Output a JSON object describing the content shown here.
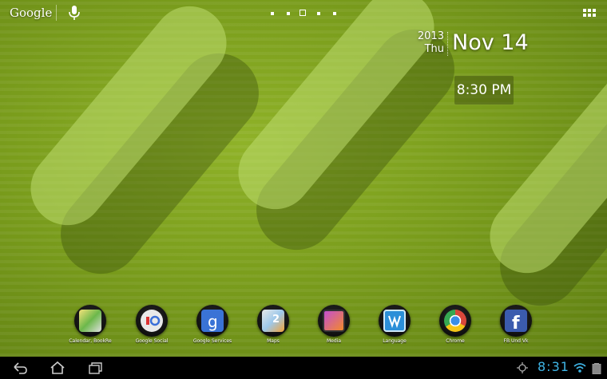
{
  "search": {
    "brand": "Google",
    "voice_icon": "microphone-icon"
  },
  "home": {
    "page_count": 5,
    "current_page": 3
  },
  "clock": {
    "year": "2013",
    "weekday": "Thu",
    "date": "Nov 14",
    "time": "8:30 PM"
  },
  "dock": {
    "apps": [
      {
        "label": "Calendar, BookRe",
        "icon": "calendar-folder-icon"
      },
      {
        "label": "Google Social",
        "icon": "google-social-folder-icon"
      },
      {
        "label": "Google Services",
        "icon": "google-services-folder-icon"
      },
      {
        "label": "Maps",
        "icon": "maps-folder-icon"
      },
      {
        "label": "Media",
        "icon": "media-folder-icon"
      },
      {
        "label": "Language",
        "icon": "language-folder-icon"
      },
      {
        "label": "Chrome",
        "icon": "chrome-icon"
      },
      {
        "label": "FB Und Vk",
        "icon": "facebook-folder-icon"
      }
    ]
  },
  "status": {
    "time": "8:31"
  },
  "colors": {
    "accent": "#3fb5e6",
    "wallpaper": "#7a9a1c"
  }
}
